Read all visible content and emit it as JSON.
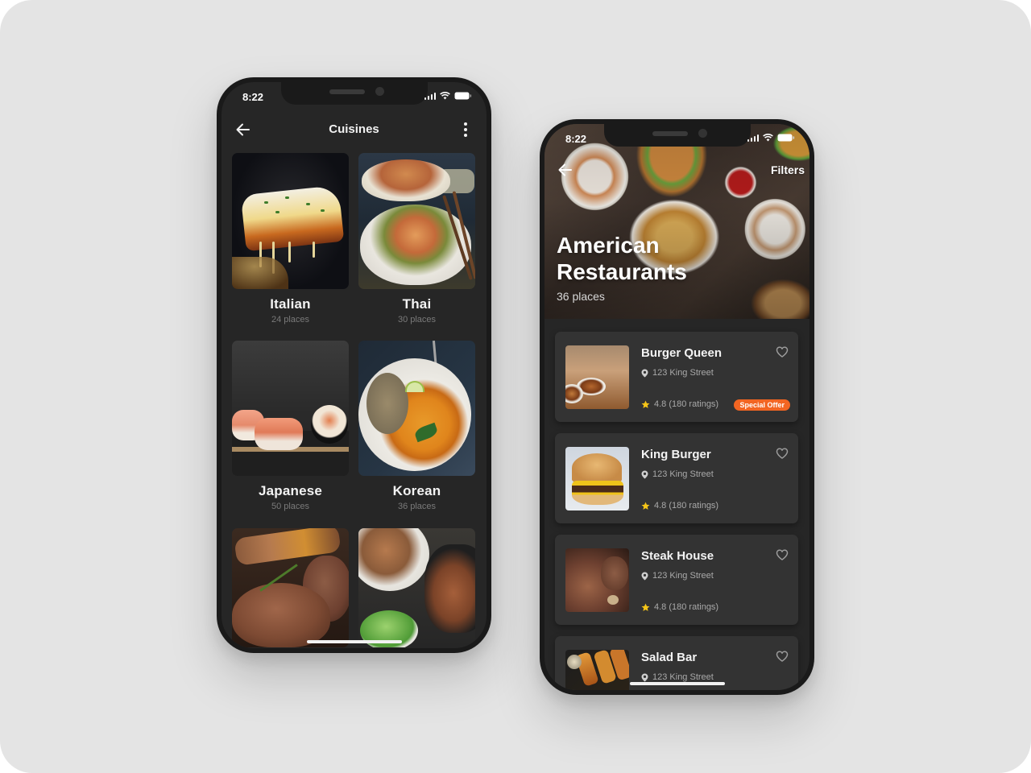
{
  "colors": {
    "background": "#e4e4e4",
    "phone_frame": "#1a1a1a",
    "screen_bg": "#262626",
    "card_bg": "#333333",
    "accent_orange": "#f26522",
    "star_yellow": "#f5c518",
    "text_primary": "#f3f3f3",
    "text_secondary": "#a9a9a9",
    "text_muted": "#7a7a7a"
  },
  "left_phone": {
    "status": {
      "time": "8:22",
      "icons": [
        "signal-icon",
        "wifi-icon",
        "battery-icon"
      ]
    },
    "header": {
      "title": "Cuisines",
      "back_icon": "arrow-left-icon",
      "menu_icon": "more-vertical-icon"
    },
    "cuisines": [
      {
        "name": "Italian",
        "count": "24 places",
        "image": "lasagna"
      },
      {
        "name": "Thai",
        "count": "30 places",
        "image": "pad-thai"
      },
      {
        "name": "Japanese",
        "count": "50 places",
        "image": "sushi"
      },
      {
        "name": "Korean",
        "count": "36 places",
        "image": "curry-bowl"
      },
      {
        "name": "",
        "count": "",
        "image": "grilled-steak"
      },
      {
        "name": "",
        "count": "",
        "image": "noodle-platter"
      }
    ]
  },
  "right_phone": {
    "status": {
      "time": "8:22",
      "icons": [
        "signal-icon",
        "wifi-icon",
        "battery-icon"
      ]
    },
    "hero": {
      "back_icon": "arrow-left-icon",
      "filters_label": "Filters",
      "title_line1": "American",
      "title_line2": "Restaurants",
      "subtitle": "36 places"
    },
    "restaurants": [
      {
        "name": "Burger Queen",
        "address": "123 King Street",
        "rating": "4.8 (180 ratings)",
        "badge": "Special Offer",
        "favorite": false
      },
      {
        "name": "King Burger",
        "address": "123 King Street",
        "rating": "4.8 (180 ratings)",
        "badge": "",
        "favorite": false
      },
      {
        "name": "Steak House",
        "address": "123 King Street",
        "rating": "4.8 (180 ratings)",
        "badge": "",
        "favorite": false
      },
      {
        "name": "Salad Bar",
        "address": "123 King Street",
        "rating": "",
        "badge": "",
        "favorite": false
      }
    ]
  }
}
